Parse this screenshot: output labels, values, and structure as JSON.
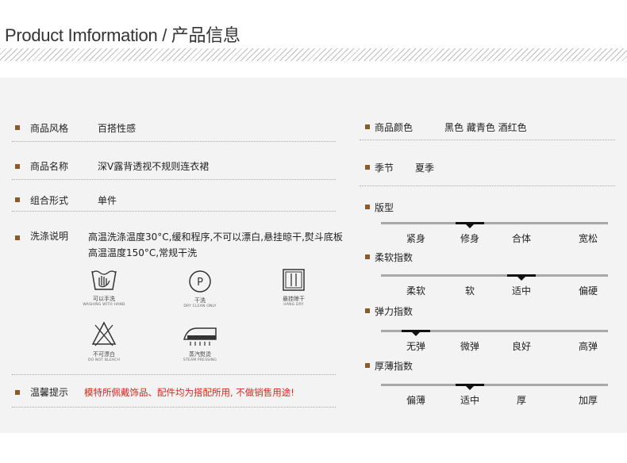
{
  "header": {
    "title": "Product Imformation / 产品信息"
  },
  "left": {
    "style": {
      "label": "商品风格",
      "value": "百搭性感"
    },
    "name": {
      "label": "商品名称",
      "value": "深V露背透视不规则连衣裙"
    },
    "form": {
      "label": "组合形式",
      "value": "单件"
    },
    "wash": {
      "label": "洗涤说明",
      "text": "高温洗涤温度30°C,缓和程序,不可以漂白,悬挂晾干,熨斗底板高温温度150°C,常规干洗",
      "icons": [
        {
          "icon": "hand-wash-icon",
          "cn": "可以手洗",
          "en": "WASHING WITH HAND"
        },
        {
          "icon": "dry-clean-icon",
          "cn": "干洗",
          "en": "DRY CLEAN ONLY"
        },
        {
          "icon": "hang-dry-icon",
          "cn": "悬挂晾干",
          "en": "HANG DRY"
        },
        {
          "icon": "no-bleach-icon",
          "cn": "不可漂白",
          "en": "DO NOT BLEACH"
        },
        {
          "icon": "steam-iron-icon",
          "cn": "蒸汽熨烫",
          "en": "STEAM PRESSING"
        }
      ]
    },
    "tips": {
      "label": "温馨提示",
      "value": "模特所佩戴饰品、配件均为搭配所用, 不做销售用途!"
    }
  },
  "right": {
    "color": {
      "label": "商品颜色",
      "value": "黑色 藏青色 酒红色"
    },
    "season": {
      "label": "季节",
      "value": "夏季"
    },
    "scales": [
      {
        "label": "版型",
        "options": [
          "紧身",
          "修身",
          "合体",
          "宽松"
        ],
        "selected": 1
      },
      {
        "label": "柔软指数",
        "options": [
          "柔软",
          "软",
          "适中",
          "偏硬"
        ],
        "selected": 2
      },
      {
        "label": "弹力指数",
        "options": [
          "无弹",
          "微弹",
          "良好",
          "高弹"
        ],
        "selected": 0
      },
      {
        "label": "厚薄指数",
        "options": [
          "偏薄",
          "适中",
          "厚",
          "加厚"
        ],
        "selected": 1
      }
    ]
  },
  "colors": {
    "bullet": "#8b5a2b",
    "warning": "#d8281e",
    "panel": "#f3f3f3"
  }
}
